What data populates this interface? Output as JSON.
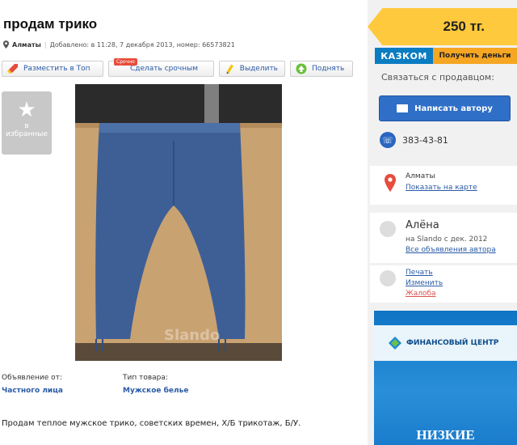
{
  "listing": {
    "title": "продам трико",
    "city": "Алматы",
    "added": "Добавлено: в 11:28, 7 декабря 2013, номер: 66573821"
  },
  "toolbar": {
    "promote_top": "Разместить в Топ",
    "urgent_badge": "Срочно",
    "make_urgent": "Сделать срочным",
    "highlight": "Выделить",
    "raise": "Поднять"
  },
  "favorite": {
    "label_line1": "в",
    "label_line2": "избранные"
  },
  "details": {
    "from_label": "Объявление от:",
    "from_value": "Частного лица",
    "type_label": "Тип товара:",
    "type_value": "Мужское белье"
  },
  "description": "Продам теплое мужское трико, советских времен, Х/Б трикотаж, Б/У.",
  "photo_watermark": "Slando",
  "sidebar": {
    "price": "250 тг.",
    "kazkom_logo": "КАЗКОМ",
    "kazkom_cta": "Получить деньги",
    "contact_heading": "Связаться с продавцом:",
    "write_button": "Написать автору",
    "phone": "383-43-81",
    "location_city": "Алматы",
    "show_on_map": "Показать на карте",
    "seller_name": "Алёна",
    "seller_since": "на Slando с дек. 2012",
    "seller_all_ads": "Все объявления автора",
    "print": "Печать",
    "edit": "Изменить",
    "complain": "Жалоба",
    "banner_brand": "ФИНАНСОВЫЙ ЦЕНТР",
    "banner_headline": "НИЗКИЕ"
  },
  "colors": {
    "accent_blue": "#2a5aa6",
    "price_yellow": "#ffc93d",
    "button_blue": "#2f6fc7",
    "complaint_red": "#d9534f"
  }
}
